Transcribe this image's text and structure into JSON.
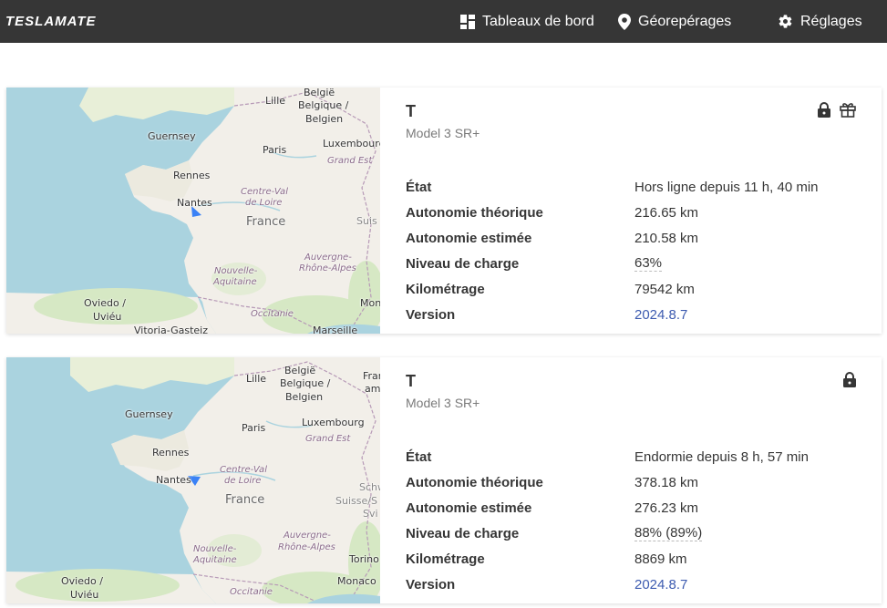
{
  "app": {
    "brand": "TESLAMATE"
  },
  "nav": {
    "dashboards": "Tableaux de bord",
    "geofences": "Géorepérages",
    "settings": "Réglages"
  },
  "map_labels": {
    "belgie": "België",
    "belgique": "Belgique /",
    "belgien": "Belgien",
    "lille": "Lille",
    "guernsey": "Guernsey",
    "paris": "Paris",
    "luxembourg": "Luxembourg",
    "grand_est": "Grand Est",
    "rennes": "Rennes",
    "nantes": "Nantes",
    "centre_val": "Centre-Val",
    "de_loire": "de Loire",
    "france": "France",
    "suis": "Suis",
    "auvergne": "Auvergne-",
    "rhone_alpes": "Rhône-Alpes",
    "nouvelle": "Nouvelle-",
    "aquitaine": "Aquitaine",
    "oviedo": "Oviedo /",
    "uvieu": "Uviéu",
    "occitanie": "Occitanie",
    "vitoria": "Vitoria-Gasteiz",
    "marseille": "Marseille",
    "mon": "Mon",
    "fran": "Fran",
    "am": "am",
    "schw": "Schw",
    "suisse": "Suisse/S",
    "svi": "Svi",
    "torino": "Torino",
    "monaco": "Monaco"
  },
  "cars": [
    {
      "name": "T",
      "model": "Model 3 SR+",
      "rows": [
        {
          "label": "État",
          "value": "Hors ligne depuis 11 h, 40 min"
        },
        {
          "label": "Autonomie théorique",
          "value": "216.65 km"
        },
        {
          "label": "Autonomie estimée",
          "value": "210.58 km"
        },
        {
          "label": "Niveau de charge",
          "value": "63%"
        },
        {
          "label": "Kilométrage",
          "value": "79542 km"
        },
        {
          "label": "Version",
          "value": "2024.8.7"
        }
      ],
      "icons": [
        "lock-icon",
        "gift-icon"
      ]
    },
    {
      "name": "T",
      "model": "Model 3 SR+",
      "rows": [
        {
          "label": "État",
          "value": "Endormie depuis 8 h, 57 min"
        },
        {
          "label": "Autonomie théorique",
          "value": "378.18 km"
        },
        {
          "label": "Autonomie estimée",
          "value": "276.23 km"
        },
        {
          "label": "Niveau de charge",
          "value": "88% (89%)"
        },
        {
          "label": "Kilométrage",
          "value": "8869 km"
        },
        {
          "label": "Version",
          "value": "2024.8.7"
        }
      ],
      "icons": [
        "lock-icon"
      ]
    }
  ],
  "colors": {
    "navbar": "#363636",
    "sea": "#aad3df",
    "land": "#f2efe9",
    "green": "#d6e8c4",
    "marker": "#3b82f6",
    "link": "#3d5bb0"
  }
}
